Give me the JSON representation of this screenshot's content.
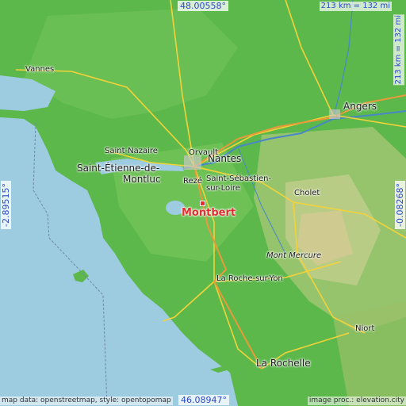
{
  "coordinates": {
    "top_lat": "48.00558°",
    "bottom_lat": "46.08947°",
    "left_lon": "-2.89515°",
    "right_lon": "-0.08268°"
  },
  "scale": {
    "horizontal": "213 km = 132 mi",
    "vertical": "213 km = 132 mi"
  },
  "target": {
    "name": "Montbert"
  },
  "places": {
    "vannes": "Vannes",
    "angers": "Angers",
    "saint_nazaire": "Saint-Nazaire",
    "orvault": "Orvault",
    "nantes": "Nantes",
    "saint_etienne_line1": "Saint-Étienne-de-",
    "saint_etienne_line2": "Montluc",
    "reze": "Rezé",
    "saint_sebastien_line1": "Saint-Sébastien-",
    "saint_sebastien_line2": "sur-Loire",
    "cholet": "Cholet",
    "mont_mercure": "Mont Mercure",
    "la_roche_sur_yon": "La Roche-sur-Yon",
    "niort": "Niort",
    "la_rochelle": "La Rochelle"
  },
  "credits": {
    "left": "map data: openstreetmap, style: opentopomap",
    "right": "image proc.: elevation.city"
  }
}
